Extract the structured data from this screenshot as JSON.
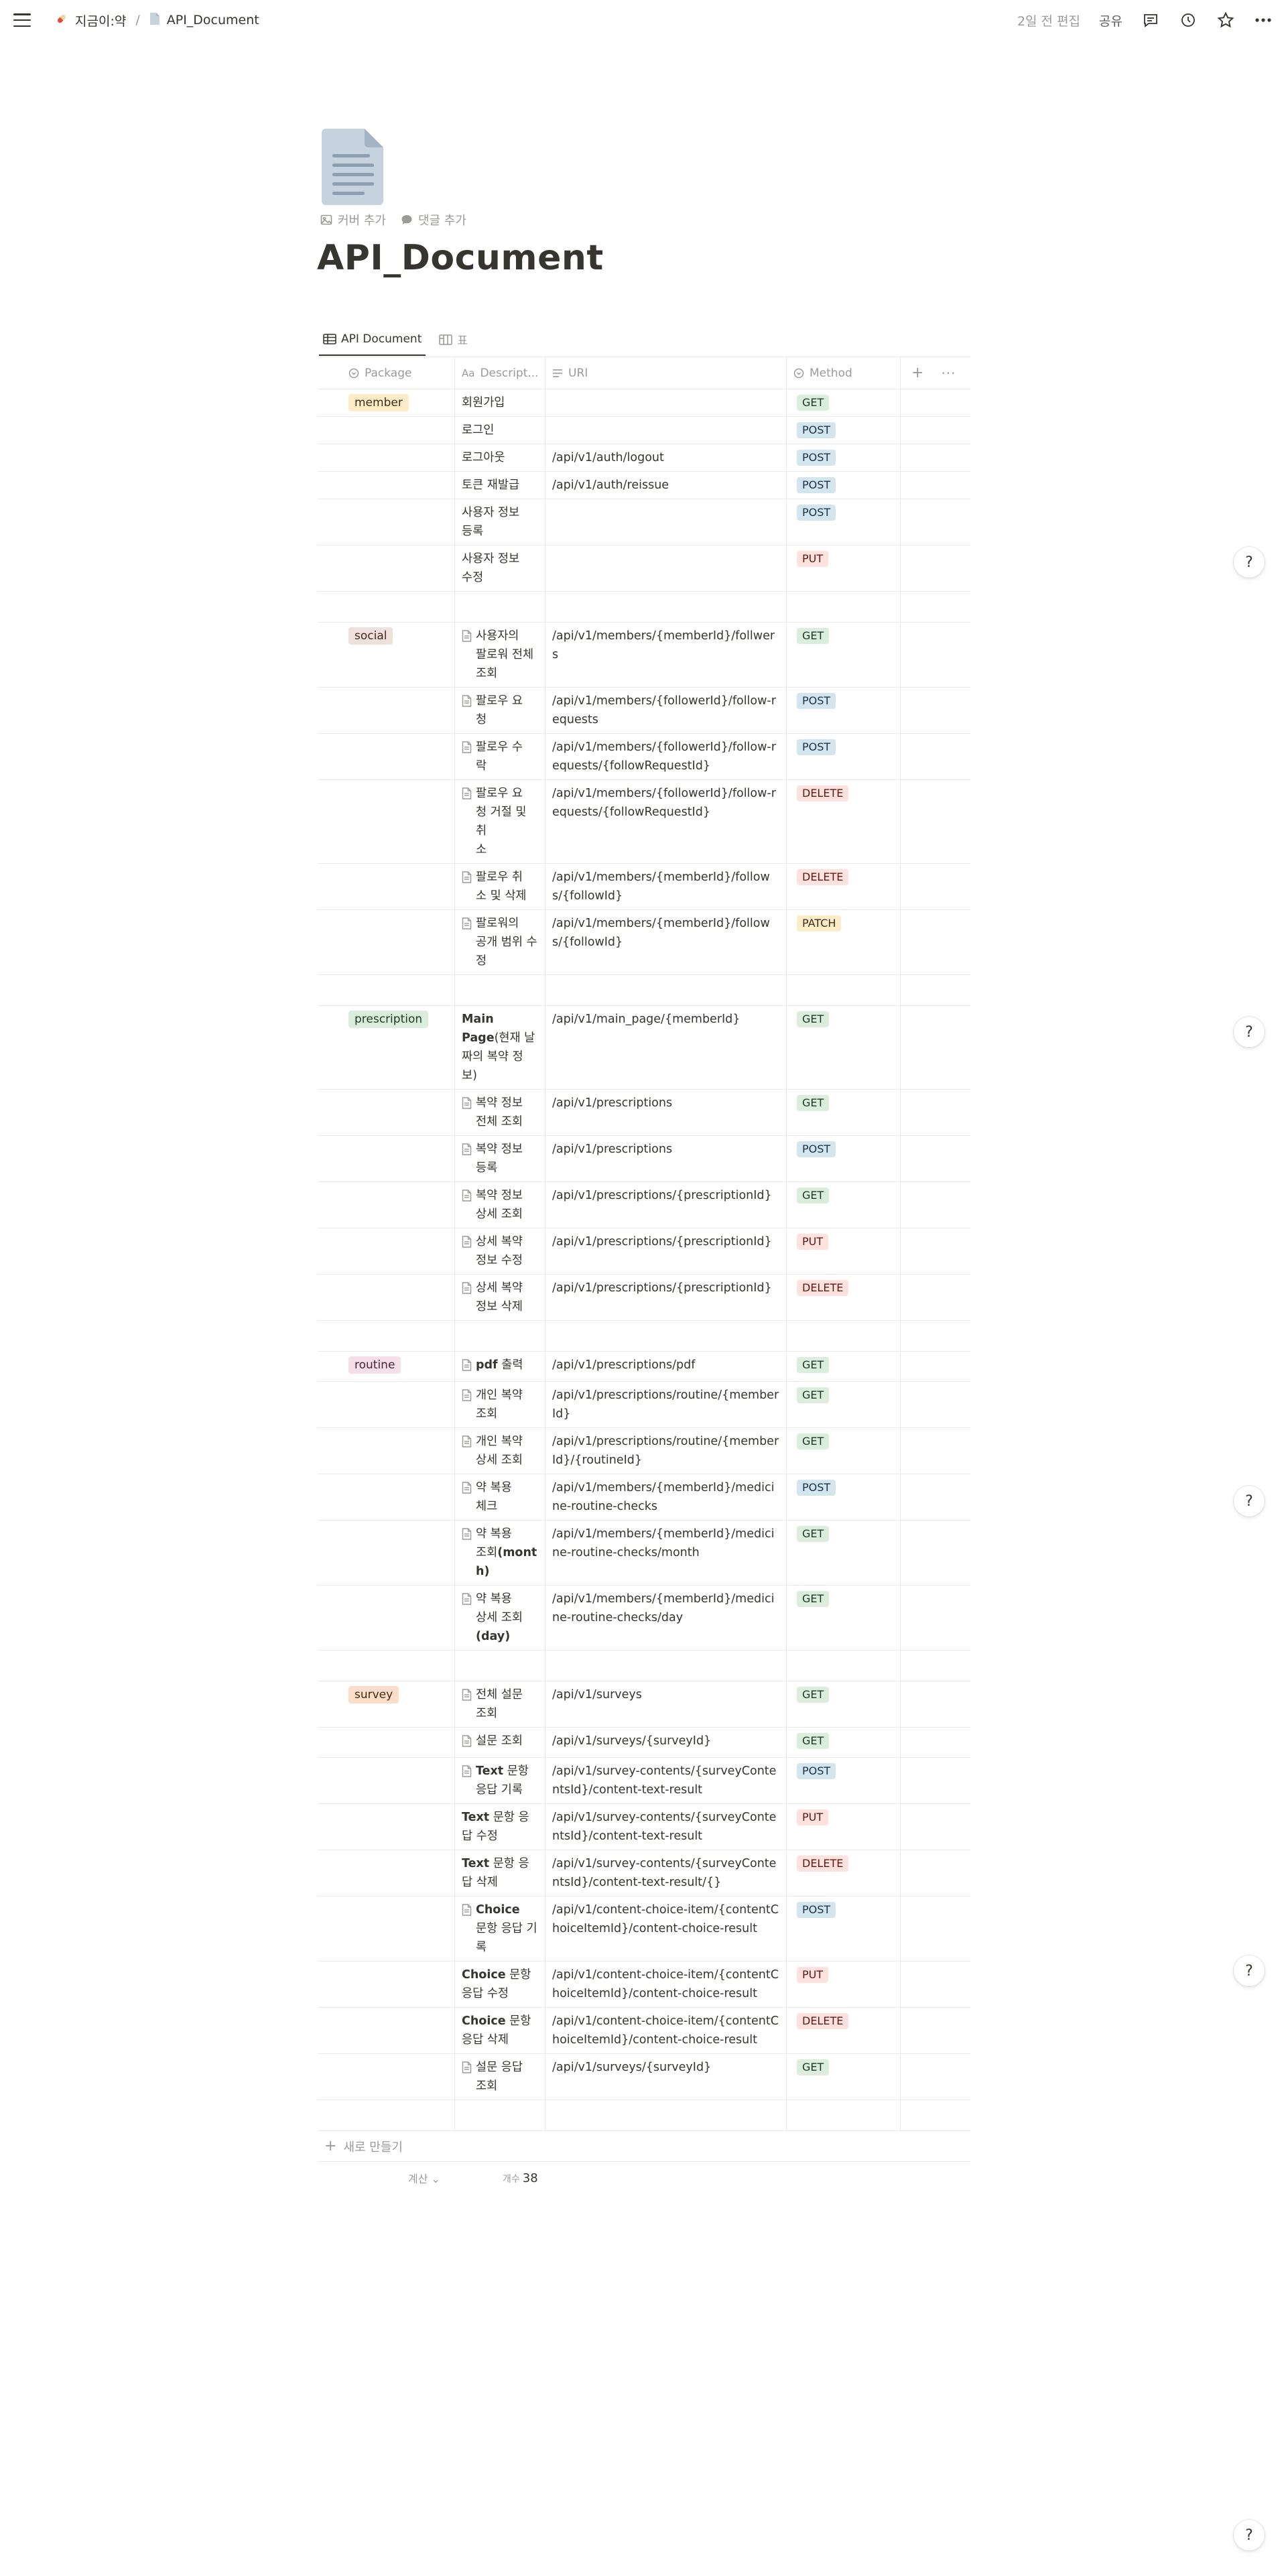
{
  "topbar": {
    "breadcrumb": [
      "지금이:약",
      "API_Document"
    ],
    "edited": "2일 전 편집",
    "share": "공유"
  },
  "page": {
    "title": "API_Document",
    "add_cover": "커버 추가",
    "add_comment": "댓글 추가"
  },
  "tabs": [
    {
      "label": "API Document",
      "active": true
    },
    {
      "label": "표",
      "active": false
    }
  ],
  "columns": {
    "package": "Package",
    "description": "Descript...",
    "uri": "URI",
    "method": "Method"
  },
  "rows": [
    {
      "package": "member",
      "desc": [
        "회원가입"
      ],
      "icon": false,
      "uri": "",
      "method": "GET"
    },
    {
      "package": "",
      "desc": [
        "로그인"
      ],
      "icon": false,
      "uri": "",
      "method": "POST"
    },
    {
      "package": "",
      "desc": [
        "로그아웃"
      ],
      "icon": false,
      "uri": "/api/v1/auth/logout",
      "method": "POST"
    },
    {
      "package": "",
      "desc": [
        "토큰 재발급"
      ],
      "icon": false,
      "uri": "/api/v1/auth/reissue",
      "method": "POST"
    },
    {
      "package": "",
      "desc": [
        "사용자 정보",
        "등록"
      ],
      "icon": false,
      "uri": "",
      "method": "POST"
    },
    {
      "package": "",
      "desc": [
        "사용자 정보",
        "수정"
      ],
      "icon": false,
      "uri": "",
      "method": "PUT"
    },
    {
      "package": "",
      "desc": [],
      "icon": false,
      "uri": "",
      "method": ""
    },
    {
      "package": "social",
      "desc": [
        "사용자의",
        "팔로워 전체",
        "조회"
      ],
      "icon": true,
      "uri": "/api/v1/members/{memberId}/follwers",
      "method": "GET"
    },
    {
      "package": "",
      "desc": [
        "팔로우 요",
        "청"
      ],
      "icon": true,
      "uri": "/api/v1/members/{followerId}/follow-requests",
      "method": "POST"
    },
    {
      "package": "",
      "desc": [
        "팔로우 수",
        "락"
      ],
      "icon": true,
      "uri": "/api/v1/members/{followerId}/follow-requests/{followRequestId}",
      "method": "POST"
    },
    {
      "package": "",
      "desc": [
        "팔로우 요",
        "청 거절 및 취",
        "소"
      ],
      "icon": true,
      "uri": "/api/v1/members/{followerId}/follow-requests/{followRequestId}",
      "method": "DELETE"
    },
    {
      "package": "",
      "desc": [
        "팔로우 취",
        "소 및 삭제"
      ],
      "icon": true,
      "uri": "/api/v1/members/{memberId}/follows/{followId}",
      "method": "DELETE"
    },
    {
      "package": "",
      "desc": [
        "팔로워의",
        "공개 범위 수",
        "정"
      ],
      "icon": true,
      "uri": "/api/v1/members/{memberId}/follows/{followId}",
      "method": "PATCH"
    },
    {
      "package": "",
      "desc": [],
      "icon": false,
      "uri": "",
      "method": ""
    },
    {
      "package": "prescription",
      "desc": [
        "**Main**",
        "**Page**(현재 날",
        "짜의 복약 정",
        "보)"
      ],
      "icon": false,
      "uri": "/api/v1/main_page/{memberId}",
      "method": "GET"
    },
    {
      "package": "",
      "desc": [
        "복약 정보",
        "전체 조회"
      ],
      "icon": true,
      "uri": "/api/v1/prescriptions",
      "method": "GET"
    },
    {
      "package": "",
      "desc": [
        "복약 정보",
        "등록"
      ],
      "icon": true,
      "uri": "/api/v1/prescriptions",
      "method": "POST"
    },
    {
      "package": "",
      "desc": [
        "복약 정보",
        "상세 조회"
      ],
      "icon": true,
      "uri": "/api/v1/prescriptions/{prescriptionId}",
      "method": "GET"
    },
    {
      "package": "",
      "desc": [
        "상세 복약",
        "정보 수정"
      ],
      "icon": true,
      "uri": "/api/v1/prescriptions/{prescriptionId}",
      "method": "PUT"
    },
    {
      "package": "",
      "desc": [
        "상세 복약",
        "정보 삭제"
      ],
      "icon": true,
      "uri": "/api/v1/prescriptions/{prescriptionId}",
      "method": "DELETE"
    },
    {
      "package": "",
      "desc": [],
      "icon": false,
      "uri": "",
      "method": ""
    },
    {
      "package": "routine",
      "desc": [
        "**pdf** 출력"
      ],
      "icon": true,
      "uri": "/api/v1/prescriptions/pdf",
      "method": "GET"
    },
    {
      "package": "",
      "desc": [
        "개인 복약",
        "조회"
      ],
      "icon": true,
      "uri": "/api/v1/prescriptions/routine/{memberId}",
      "method": "GET"
    },
    {
      "package": "",
      "desc": [
        "개인 복약",
        "상세 조회"
      ],
      "icon": true,
      "uri": "/api/v1/prescriptions/routine/{memberId}/{routineId}",
      "method": "GET"
    },
    {
      "package": "",
      "desc": [
        "약 복용",
        "체크"
      ],
      "icon": true,
      "uri": "/api/v1/members/{memberId}/medicine-routine-checks",
      "method": "POST"
    },
    {
      "package": "",
      "desc": [
        "약 복용",
        "조회**(month)**"
      ],
      "icon": true,
      "uri": "/api/v1/members/{memberId}/medicine-routine-checks/month",
      "method": "GET"
    },
    {
      "package": "",
      "desc": [
        "약 복용",
        "상세 조회",
        "**(day)**"
      ],
      "icon": true,
      "uri": "/api/v1/members/{memberId}/medicine-routine-checks/day",
      "method": "GET"
    },
    {
      "package": "",
      "desc": [],
      "icon": false,
      "uri": "",
      "method": ""
    },
    {
      "package": "survey",
      "desc": [
        "전체 설문",
        "조회"
      ],
      "icon": true,
      "uri": "/api/v1/surveys",
      "method": "GET"
    },
    {
      "package": "",
      "desc": [
        "설문 조회"
      ],
      "icon": true,
      "uri": "/api/v1/surveys/{surveyId}",
      "method": "GET"
    },
    {
      "package": "",
      "desc": [
        "**Text** 문항",
        "응답 기록"
      ],
      "icon": true,
      "uri": "/api/v1/survey-contents/{surveyContentsId}/content-text-result",
      "method": "POST"
    },
    {
      "package": "",
      "desc": [
        "**Text** 문항 응",
        "답 수정"
      ],
      "icon": false,
      "uri": "/api/v1/survey-contents/{surveyContentsId}/content-text-result",
      "method": "PUT"
    },
    {
      "package": "",
      "desc": [
        "**Text** 문항 응",
        "답 삭제"
      ],
      "icon": false,
      "uri": "/api/v1/survey-contents/{surveyContentsId}/content-text-result/{}",
      "method": "DELETE"
    },
    {
      "package": "",
      "desc": [
        "**Choice**",
        "문항 응답 기",
        "록"
      ],
      "icon": true,
      "uri": "/api/v1/content-choice-item/{contentChoiceItemId}/content-choice-result",
      "method": "POST"
    },
    {
      "package": "",
      "desc": [
        "**Choice** 문항",
        "응답 수정"
      ],
      "icon": false,
      "uri": "/api/v1/content-choice-item/{contentChoiceItemId}/content-choice-result",
      "method": "PUT"
    },
    {
      "package": "",
      "desc": [
        "**Choice** 문항",
        "응답 삭제"
      ],
      "icon": false,
      "uri": "/api/v1/content-choice-item/{contentChoiceItemId}/content-choice-result",
      "method": "DELETE"
    },
    {
      "package": "",
      "desc": [
        "설문 응답",
        "조회"
      ],
      "icon": true,
      "uri": "/api/v1/surveys/{surveyId}",
      "method": "GET"
    },
    {
      "package": "",
      "desc": [],
      "icon": false,
      "uri": "",
      "method": ""
    }
  ],
  "package_colors": {
    "member": {
      "bg": "#fdecc8",
      "fg": "#402c1b"
    },
    "social": {
      "bg": "#eee0da",
      "fg": "#442a1e"
    },
    "prescription": {
      "bg": "#dbeddb",
      "fg": "#1c3829"
    },
    "routine": {
      "bg": "#f5e0e9",
      "fg": "#4c2337"
    },
    "survey": {
      "bg": "#fadec9",
      "fg": "#49290e"
    }
  },
  "footer": {
    "new_row": "새로 만들기",
    "calculate": "계산",
    "count_label": "개수",
    "count_value": "38"
  },
  "help_label": "?"
}
